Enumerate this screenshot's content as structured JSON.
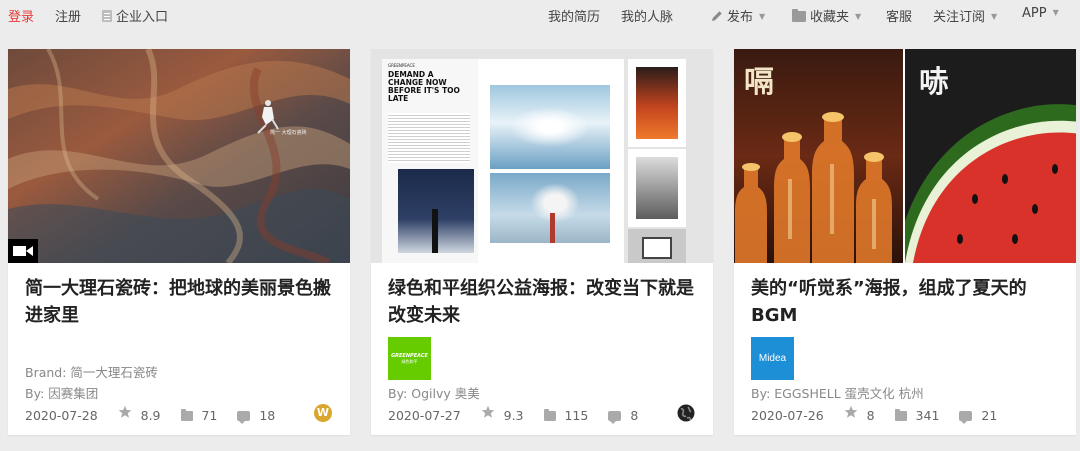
{
  "nav": {
    "left": [
      "登录",
      "注册",
      "企业入口"
    ],
    "right": [
      "我的简历",
      "我的人脉",
      "发布",
      "收藏夹",
      "客服",
      "关注订阅",
      "APP"
    ]
  },
  "cards": [
    {
      "title": "简一大理石瓷砖：把地球的美丽景色搬进家里",
      "brand": "Brand: 简一大理石瓷砖",
      "by": "By: 因赛集团",
      "date": "2020-07-28",
      "rating": "8.9",
      "favorites": "71",
      "comments": "18",
      "thumb_caption": "简一 大理石瓷砖",
      "badge_letter": "W"
    },
    {
      "title": "绿色和平组织公益海报：改变当下就是改变未来",
      "logo_text": "GREENPEACE",
      "logo_sub": "绿色和平",
      "by": "By: Ogilvy 奥美",
      "date": "2020-07-27",
      "rating": "9.3",
      "favorites": "115",
      "comments": "8",
      "poster_headline": "DEMAND A CHANGE NOW BEFORE IT'S TOO LATE",
      "poster_brand": "GREENPEACE"
    },
    {
      "title": "美的“听觉系”海报，组成了夏天的BGM",
      "logo_text": "Midea",
      "by": "By: EGGSHELL 蛋壳文化 杭州",
      "date": "2020-07-26",
      "rating": "8",
      "favorites": "341",
      "comments": "21",
      "poster_chars": [
        "嗝",
        "哧"
      ]
    }
  ],
  "colors": {
    "accent_login": "#e83a3a",
    "greenpeace_green": "#66cc00",
    "midea_blue": "#1d8fd6",
    "badge_gold": "#d9a72f"
  }
}
